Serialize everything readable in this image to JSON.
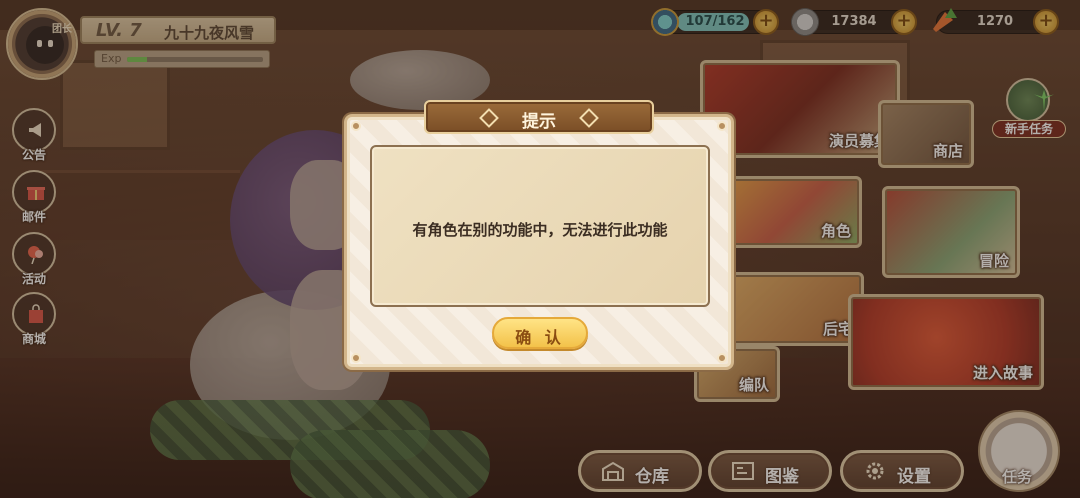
{
  "player": {
    "guild_badge": "团长",
    "level": "LV. 7",
    "name": "九十九夜风雪",
    "exp_label": "Exp",
    "exp_fraction": 0.15
  },
  "resources": {
    "stamina": {
      "value": "107/162",
      "icon": "stamina-icon"
    },
    "coin": {
      "value": "17384",
      "icon": "coin-icon"
    },
    "carrot": {
      "value": "1270",
      "icon": "carrot-icon"
    },
    "plus": "+"
  },
  "left_menu": [
    {
      "label": "公告",
      "icon": "megaphone-icon"
    },
    {
      "label": "邮件",
      "icon": "gift-mail-icon"
    },
    {
      "label": "活动",
      "icon": "balloon-icon"
    },
    {
      "label": "商城",
      "icon": "shop-bag-icon"
    }
  ],
  "right_menu": {
    "recruit": "演员募集",
    "shop": "商店",
    "character": "角色",
    "adventure": "冒险",
    "backyard": "后宅",
    "story": "进入故事",
    "team": "编队",
    "newbie": "新手任务"
  },
  "bottom_bar": {
    "warehouse": "仓库",
    "catalog": "图鉴",
    "settings": "设置",
    "mission": "任务"
  },
  "dialog": {
    "title": "提示",
    "message": "有角色在别的功能中，无法进行此功能",
    "confirm": "确 认"
  }
}
